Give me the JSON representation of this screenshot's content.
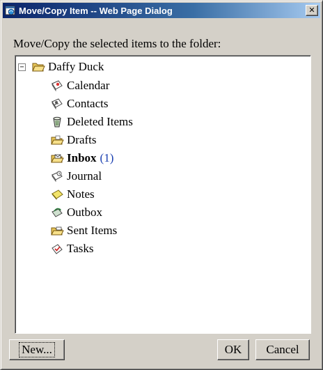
{
  "window": {
    "title": "Move/Copy Item -- Web Page Dialog",
    "close_label": "✕"
  },
  "instruction": "Move/Copy the selected items to the folder:",
  "tree": {
    "root": {
      "label": "Daffy Duck",
      "expander": "−",
      "icon": "folder-open-icon"
    },
    "items": [
      {
        "label": "Calendar",
        "icon": "calendar-icon"
      },
      {
        "label": "Contacts",
        "icon": "contacts-icon"
      },
      {
        "label": "Deleted Items",
        "icon": "trash-icon"
      },
      {
        "label": "Drafts",
        "icon": "drafts-folder-icon"
      },
      {
        "label": "Inbox",
        "count": "(1)",
        "bold": true,
        "icon": "inbox-icon"
      },
      {
        "label": "Journal",
        "icon": "journal-icon"
      },
      {
        "label": "Notes",
        "icon": "notes-icon"
      },
      {
        "label": "Outbox",
        "icon": "outbox-icon"
      },
      {
        "label": "Sent Items",
        "icon": "sent-items-icon"
      },
      {
        "label": "Tasks",
        "icon": "tasks-icon"
      }
    ]
  },
  "buttons": {
    "new_label": "New...",
    "ok_label": "OK",
    "cancel_label": "Cancel"
  },
  "colors": {
    "title_bar": "#0a246a",
    "dialog_face": "#d4d0c8",
    "count_text": "#1a3fb0"
  }
}
